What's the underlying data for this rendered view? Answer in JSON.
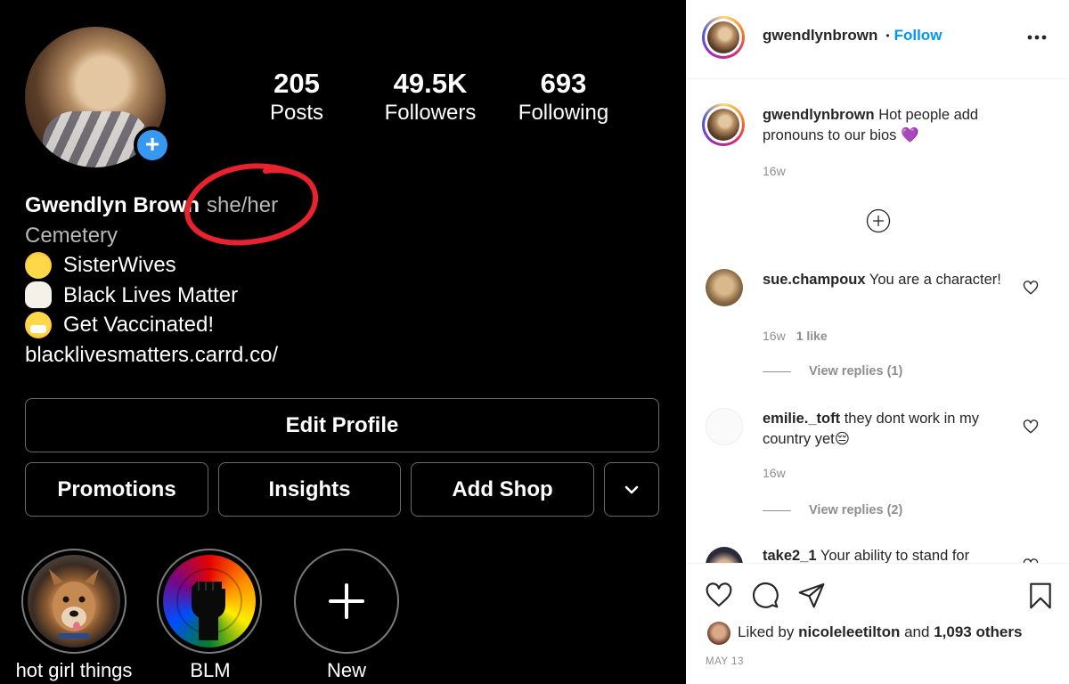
{
  "profile": {
    "stats": [
      {
        "value": "205",
        "label": "Posts"
      },
      {
        "value": "49.5K",
        "label": "Followers"
      },
      {
        "value": "693",
        "label": "Following"
      }
    ],
    "name": "Gwendlyn Brown",
    "pronouns": "she/her",
    "category": "Cemetery",
    "bio_lines": [
      {
        "emoji": "smiling-face-with-hearts-emoji",
        "text": "SisterWives"
      },
      {
        "emoji": "raised-fist-emoji",
        "text": "Black Lives Matter"
      },
      {
        "emoji": "face-with-medical-mask-emoji",
        "text": "Get Vaccinated!"
      }
    ],
    "link": "blacklivesmatters.carrd.co/",
    "buttons": {
      "edit_profile": "Edit Profile",
      "promotions": "Promotions",
      "insights": "Insights",
      "add_shop": "Add Shop"
    },
    "highlights": [
      {
        "label": "hot girl things"
      },
      {
        "label": "BLM"
      },
      {
        "label": "New"
      }
    ],
    "accent_color": "#3897f0",
    "annotation_color": "#e8232d"
  },
  "post": {
    "username": "gwendlynbrown",
    "follow_label": "Follow",
    "separator": "•",
    "caption": {
      "username": "gwendlynbrown",
      "text": "Hot people add pronouns to our bios 💜",
      "time": "16w"
    },
    "comments": [
      {
        "username": "sue.champoux",
        "text": "You are a character!",
        "time": "16w",
        "likes": "1 like",
        "replies": "View replies (1)"
      },
      {
        "username": "emilie._toft",
        "text": "they dont work in my country yet😔",
        "time": "16w",
        "likes": "",
        "replies": "View replies (2)"
      },
      {
        "username": "take2_1",
        "text": "Your ability to stand for",
        "time": "",
        "likes": "",
        "replies": ""
      }
    ],
    "liked_by": {
      "prefix": "Liked by",
      "user": "nicoleleetilton",
      "middle": "and",
      "others": "1,093 others"
    },
    "date": "MAY 13",
    "follow_color": "#0095f6"
  }
}
